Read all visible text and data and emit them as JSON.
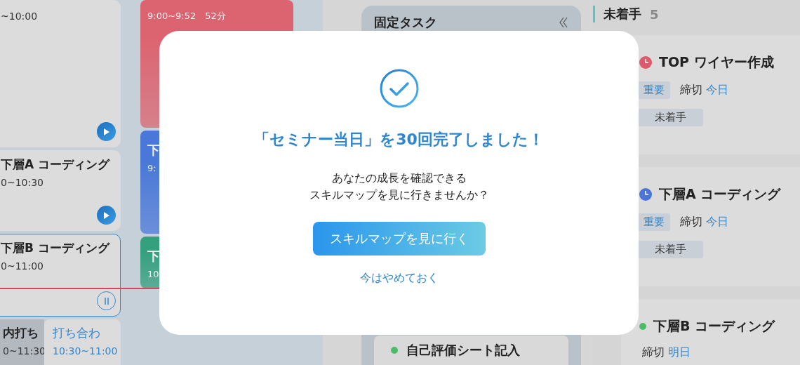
{
  "schedule_cards": [
    {
      "time": "~10:00",
      "kind": "play",
      "selected": false
    },
    {
      "title": "下層A コーディング",
      "time": "0~10:30",
      "kind": "play",
      "selected": false
    },
    {
      "title": "下層B コーディング",
      "time": "0~11:00",
      "kind": "pause",
      "selected": true
    }
  ],
  "overlap_events": [
    {
      "title": "内打ち",
      "time": "0~11:30",
      "kind": "muted"
    },
    {
      "title": "打ち合わ",
      "time": "10:30~11:00",
      "kind": "meeting"
    }
  ],
  "time_blocks": [
    {
      "time": "9:00~9:52　52分",
      "color": "#dc6470"
    },
    {
      "title": "下",
      "time": "9:",
      "color": "#4a78d8"
    },
    {
      "title": "下",
      "time": "10",
      "color": "#34a07e"
    }
  ],
  "fixed_tasks": {
    "title": "固定タスク",
    "items": [
      {
        "title": "自己評価シート記入",
        "color": "#4dbb6a"
      }
    ]
  },
  "todo": {
    "title": "未着手",
    "count": "5",
    "cards": [
      {
        "title": "TOP ワイヤー作成",
        "kind": "clock",
        "color": "#dc5a6a",
        "priority": "重要",
        "deadline_label": "締切",
        "deadline": "今日",
        "status": "未着手"
      },
      {
        "title": "下層A コーディング",
        "kind": "clock",
        "color": "#4a74d8",
        "priority": "重要",
        "deadline_label": "締切",
        "deadline": "今日",
        "status": "未着手"
      },
      {
        "title": "下層B コーディング",
        "kind": "dot",
        "color": "#4dbb6a",
        "deadline_label": "締切",
        "deadline": "明日"
      }
    ]
  },
  "modal": {
    "title": "「セミナー当日」を30回完了しました！",
    "message": [
      "あなたの成長を確認できる",
      "スキルマップを見に行きませんか？"
    ],
    "primary_button": "スキルマップを見に行く",
    "dismiss_link": "今はやめておく"
  }
}
